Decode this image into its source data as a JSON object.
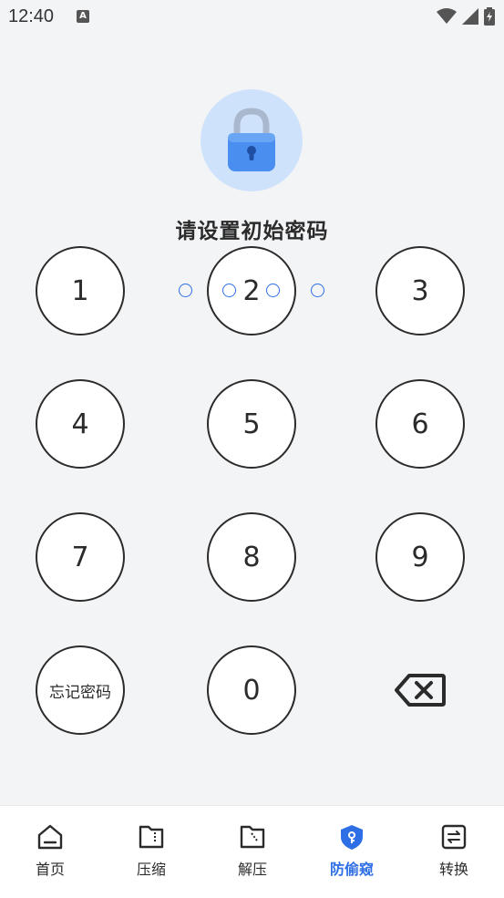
{
  "status_bar": {
    "time": "12:40",
    "notification_icon_text": "A",
    "icons": [
      "wifi-icon",
      "signal-icon",
      "battery-charging-icon"
    ]
  },
  "lock": {
    "icon": "lock-icon",
    "colors": {
      "circle": "#cfe2fb",
      "body": "#4a8ef0",
      "shackle": "#a9b8cc"
    }
  },
  "title": "请设置初始密码",
  "pin": {
    "length": 4,
    "entered": 0,
    "dot_color": "#2f6fe6"
  },
  "keypad": {
    "keys": [
      "1",
      "2",
      "3",
      "4",
      "5",
      "6",
      "7",
      "8",
      "9"
    ],
    "forgot_label": "忘记密码",
    "zero": "0",
    "delete_icon": "backspace-icon"
  },
  "bottom_nav": {
    "active_color": "#2f6fe6",
    "items": [
      {
        "label": "首页",
        "icon": "home-icon",
        "active": false
      },
      {
        "label": "压缩",
        "icon": "compress-folder-icon",
        "active": false
      },
      {
        "label": "解压",
        "icon": "extract-folder-icon",
        "active": false
      },
      {
        "label": "防偷窥",
        "icon": "shield-key-icon",
        "active": true
      },
      {
        "label": "转换",
        "icon": "convert-icon",
        "active": false
      }
    ]
  }
}
